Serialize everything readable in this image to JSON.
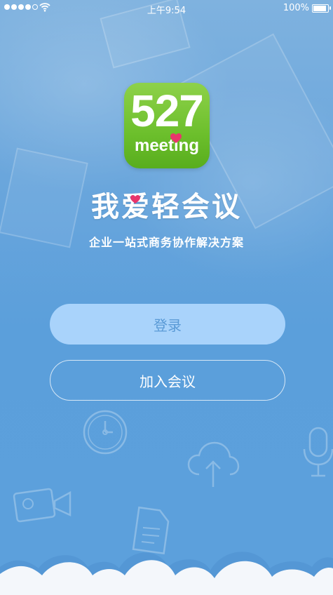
{
  "status_bar": {
    "time": "上午9:54",
    "battery_text": "100%",
    "battery_level": 1.0
  },
  "logo": {
    "number": "527",
    "word": "meeting",
    "heart_color": "#e8356b",
    "green": "#6cbf2c"
  },
  "app_title": "我爱轻会议",
  "tagline": "企业一站式商务协作解决方案",
  "buttons": {
    "login_label": "登录",
    "join_label": "加入会议"
  },
  "icons": [
    "clock-icon",
    "cloud-upload-icon",
    "microphone-icon",
    "video-camera-icon",
    "document-icon"
  ],
  "colors": {
    "background": "#5ca0dc",
    "login_button": "#a9d3fb",
    "login_text": "#5a9ad6"
  }
}
